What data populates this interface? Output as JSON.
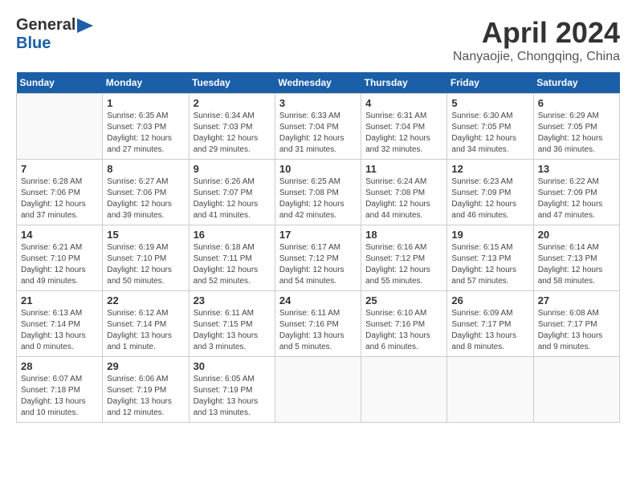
{
  "header": {
    "logo_general": "General",
    "logo_blue": "Blue",
    "month_title": "April 2024",
    "subtitle": "Nanyaojie, Chongqing, China"
  },
  "days_of_week": [
    "Sunday",
    "Monday",
    "Tuesday",
    "Wednesday",
    "Thursday",
    "Friday",
    "Saturday"
  ],
  "weeks": [
    [
      {
        "day": "",
        "content": ""
      },
      {
        "day": "1",
        "content": "Sunrise: 6:35 AM\nSunset: 7:03 PM\nDaylight: 12 hours\nand 27 minutes."
      },
      {
        "day": "2",
        "content": "Sunrise: 6:34 AM\nSunset: 7:03 PM\nDaylight: 12 hours\nand 29 minutes."
      },
      {
        "day": "3",
        "content": "Sunrise: 6:33 AM\nSunset: 7:04 PM\nDaylight: 12 hours\nand 31 minutes."
      },
      {
        "day": "4",
        "content": "Sunrise: 6:31 AM\nSunset: 7:04 PM\nDaylight: 12 hours\nand 32 minutes."
      },
      {
        "day": "5",
        "content": "Sunrise: 6:30 AM\nSunset: 7:05 PM\nDaylight: 12 hours\nand 34 minutes."
      },
      {
        "day": "6",
        "content": "Sunrise: 6:29 AM\nSunset: 7:05 PM\nDaylight: 12 hours\nand 36 minutes."
      }
    ],
    [
      {
        "day": "7",
        "content": "Sunrise: 6:28 AM\nSunset: 7:06 PM\nDaylight: 12 hours\nand 37 minutes."
      },
      {
        "day": "8",
        "content": "Sunrise: 6:27 AM\nSunset: 7:06 PM\nDaylight: 12 hours\nand 39 minutes."
      },
      {
        "day": "9",
        "content": "Sunrise: 6:26 AM\nSunset: 7:07 PM\nDaylight: 12 hours\nand 41 minutes."
      },
      {
        "day": "10",
        "content": "Sunrise: 6:25 AM\nSunset: 7:08 PM\nDaylight: 12 hours\nand 42 minutes."
      },
      {
        "day": "11",
        "content": "Sunrise: 6:24 AM\nSunset: 7:08 PM\nDaylight: 12 hours\nand 44 minutes."
      },
      {
        "day": "12",
        "content": "Sunrise: 6:23 AM\nSunset: 7:09 PM\nDaylight: 12 hours\nand 46 minutes."
      },
      {
        "day": "13",
        "content": "Sunrise: 6:22 AM\nSunset: 7:09 PM\nDaylight: 12 hours\nand 47 minutes."
      }
    ],
    [
      {
        "day": "14",
        "content": "Sunrise: 6:21 AM\nSunset: 7:10 PM\nDaylight: 12 hours\nand 49 minutes."
      },
      {
        "day": "15",
        "content": "Sunrise: 6:19 AM\nSunset: 7:10 PM\nDaylight: 12 hours\nand 50 minutes."
      },
      {
        "day": "16",
        "content": "Sunrise: 6:18 AM\nSunset: 7:11 PM\nDaylight: 12 hours\nand 52 minutes."
      },
      {
        "day": "17",
        "content": "Sunrise: 6:17 AM\nSunset: 7:12 PM\nDaylight: 12 hours\nand 54 minutes."
      },
      {
        "day": "18",
        "content": "Sunrise: 6:16 AM\nSunset: 7:12 PM\nDaylight: 12 hours\nand 55 minutes."
      },
      {
        "day": "19",
        "content": "Sunrise: 6:15 AM\nSunset: 7:13 PM\nDaylight: 12 hours\nand 57 minutes."
      },
      {
        "day": "20",
        "content": "Sunrise: 6:14 AM\nSunset: 7:13 PM\nDaylight: 12 hours\nand 58 minutes."
      }
    ],
    [
      {
        "day": "21",
        "content": "Sunrise: 6:13 AM\nSunset: 7:14 PM\nDaylight: 13 hours\nand 0 minutes."
      },
      {
        "day": "22",
        "content": "Sunrise: 6:12 AM\nSunset: 7:14 PM\nDaylight: 13 hours\nand 1 minute."
      },
      {
        "day": "23",
        "content": "Sunrise: 6:11 AM\nSunset: 7:15 PM\nDaylight: 13 hours\nand 3 minutes."
      },
      {
        "day": "24",
        "content": "Sunrise: 6:11 AM\nSunset: 7:16 PM\nDaylight: 13 hours\nand 5 minutes."
      },
      {
        "day": "25",
        "content": "Sunrise: 6:10 AM\nSunset: 7:16 PM\nDaylight: 13 hours\nand 6 minutes."
      },
      {
        "day": "26",
        "content": "Sunrise: 6:09 AM\nSunset: 7:17 PM\nDaylight: 13 hours\nand 8 minutes."
      },
      {
        "day": "27",
        "content": "Sunrise: 6:08 AM\nSunset: 7:17 PM\nDaylight: 13 hours\nand 9 minutes."
      }
    ],
    [
      {
        "day": "28",
        "content": "Sunrise: 6:07 AM\nSunset: 7:18 PM\nDaylight: 13 hours\nand 10 minutes."
      },
      {
        "day": "29",
        "content": "Sunrise: 6:06 AM\nSunset: 7:19 PM\nDaylight: 13 hours\nand 12 minutes."
      },
      {
        "day": "30",
        "content": "Sunrise: 6:05 AM\nSunset: 7:19 PM\nDaylight: 13 hours\nand 13 minutes."
      },
      {
        "day": "",
        "content": ""
      },
      {
        "day": "",
        "content": ""
      },
      {
        "day": "",
        "content": ""
      },
      {
        "day": "",
        "content": ""
      }
    ]
  ]
}
